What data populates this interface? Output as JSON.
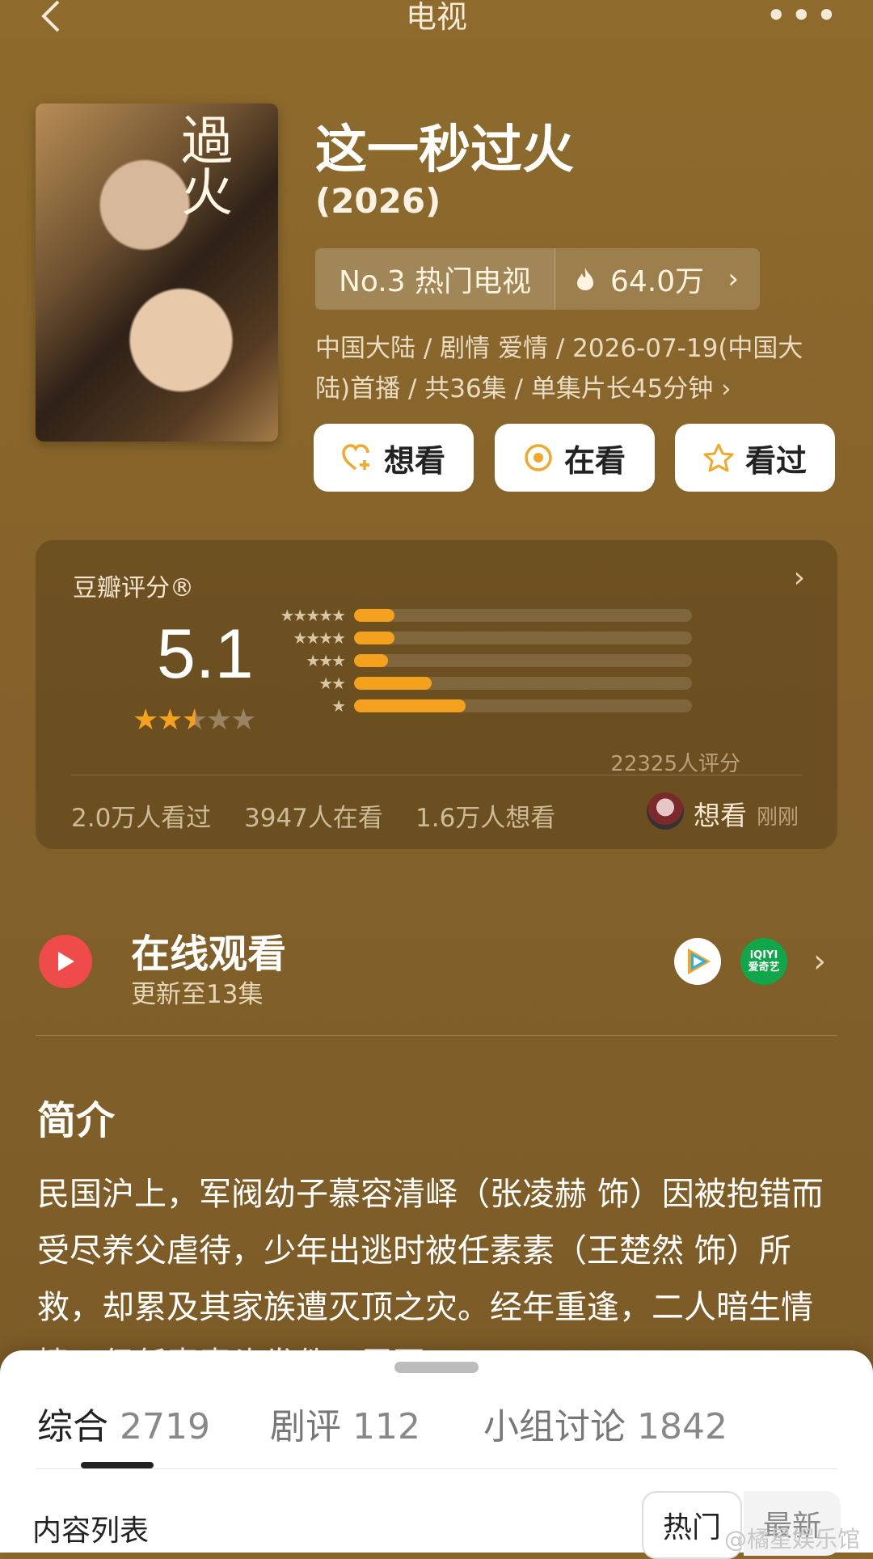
{
  "header": {
    "title": "电视",
    "back_icon": "back-arrow-icon",
    "more_icon": "more-dots-icon"
  },
  "show": {
    "title": "这一秒过火",
    "year": "(2026)",
    "poster_logo": "過火",
    "rank_label": "No.3 热门电视",
    "heat": "64.0万",
    "meta": "中国大陆 / 剧情 爱情 / 2026-07-19(中国大陆)首播 / 共36集 / 单集片长45分钟 ›"
  },
  "actions": {
    "want": "想看",
    "watching": "在看",
    "watched": "看过"
  },
  "rating": {
    "label": "豆瓣评分®",
    "score": "5.1",
    "star_fraction": 0.5,
    "count": "22325人评分",
    "bars": [
      {
        "stars": "★★★★★",
        "fraction": 0.12
      },
      {
        "stars": "★★★★",
        "fraction": 0.12
      },
      {
        "stars": "★★★",
        "fraction": 0.1
      },
      {
        "stars": "★★",
        "fraction": 0.23
      },
      {
        "stars": "★",
        "fraction": 0.33
      }
    ],
    "stats": {
      "watched": "2.0万人看过",
      "watching": "3947人在看",
      "wish": "1.6万人想看"
    },
    "friend": {
      "action": "想看",
      "time": "刚刚"
    },
    "colors": {
      "bar": "#f4a21d",
      "star": "#f4a21d"
    }
  },
  "online": {
    "title": "在线观看",
    "subtitle": "更新至13集",
    "platform_iqiyi_top": "iQIYI",
    "platform_iqiyi_bottom": "爱奇艺"
  },
  "intro": {
    "heading": "简介",
    "text": "民国沪上，军阀幼子慕容清峄（张凌赫 饰）因被抱错而受尽养父虐待，少年出逃时被任素素（王楚然 饰）所救，却累及其家族遭灭顶之灾。经年重逢，二人暗生情愫，但任素素头发件一层至"
  },
  "sheet": {
    "tabs": [
      {
        "label": "综合",
        "count": "2719"
      },
      {
        "label": "剧评",
        "count": "112"
      },
      {
        "label": "小组讨论",
        "count": "1842"
      }
    ],
    "list_label": "内容列表",
    "sort_hot": "热门",
    "sort_new": "最新",
    "watermark": "@橘星娱乐馆"
  }
}
